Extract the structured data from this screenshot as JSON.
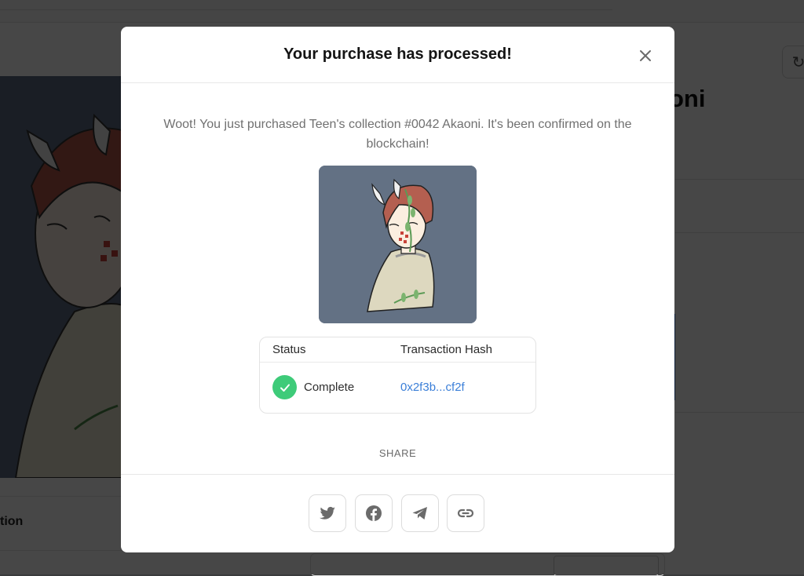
{
  "background": {
    "title_fragment": "oni",
    "section_label_fragment": "tion"
  },
  "modal": {
    "title": "Your purchase has processed!",
    "close_icon": "close-icon",
    "message": "Woot! You just purchased Teen's collection #0042 Akaoni. It's been confirmed on the blockchain!",
    "image_subject": "nft-artwork",
    "status_table": {
      "headers": [
        "Status",
        "Transaction Hash"
      ],
      "status": "Complete",
      "status_icon": "check-icon",
      "hash": "0x2f3b...cf2f"
    },
    "share_label": "SHARE",
    "share_buttons": [
      {
        "icon": "twitter-icon"
      },
      {
        "icon": "facebook-icon"
      },
      {
        "icon": "telegram-icon"
      },
      {
        "icon": "link-icon"
      }
    ]
  },
  "colors": {
    "success": "#3ecb79",
    "link": "#3b7fd8",
    "image_background": "#637184"
  }
}
